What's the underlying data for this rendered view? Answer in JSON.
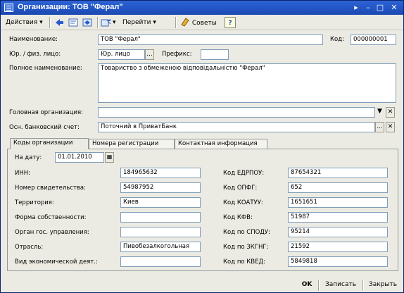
{
  "window": {
    "title": "Организации: ТОВ \"Ферал\""
  },
  "toolbar": {
    "actions_label": "Действия",
    "goto_label": "Перейти",
    "tips_label": "Советы",
    "help_label": "?"
  },
  "form": {
    "name_label": "Наименование:",
    "name_value": "ТОВ \"Ферал\"",
    "code_label": "Код:",
    "code_value": "000000001",
    "entity_label": "Юр. / физ. лицо:",
    "entity_value": "Юр. лицо",
    "prefix_label": "Префикс:",
    "prefix_value": "",
    "fullname_label": "Полное наименование:",
    "fullname_value": "Товариство з обмеженою відповідальністю \"Ферал\"",
    "head_org_label": "Головная организация:",
    "head_org_value": "",
    "bank_label": "Осн. банковский счет:",
    "bank_value": "Поточний в ПриватБанк"
  },
  "tabs": [
    {
      "label": "Коды организации",
      "active": true
    },
    {
      "label": "Номера регистрации",
      "active": false
    },
    {
      "label": "Контактная информация",
      "active": false
    }
  ],
  "codes": {
    "date_label": "На дату:",
    "date_value": "01.01.2010",
    "left": [
      {
        "label": "ИНН:",
        "value": "184965632"
      },
      {
        "label": "Номер свидетельства:",
        "value": "54987952"
      },
      {
        "label": "Территория:",
        "value": "Киев"
      },
      {
        "label": "Форма собственности:",
        "value": ""
      },
      {
        "label": "Орган гос. управления:",
        "value": ""
      },
      {
        "label": "Отрасль:",
        "value": "Пивобезалкогольная"
      },
      {
        "label": "Вид экономической деят.:",
        "value": ""
      }
    ],
    "right": [
      {
        "label": "Код ЕДРПОУ:",
        "value": "87654321"
      },
      {
        "label": "Код ОПФГ:",
        "value": "652"
      },
      {
        "label": "Код КОАТУУ:",
        "value": "1651651"
      },
      {
        "label": "Код КФВ:",
        "value": "51987"
      },
      {
        "label": "Код по СПОДУ:",
        "value": "95214"
      },
      {
        "label": "Код по ЗКГНГ:",
        "value": "21592"
      },
      {
        "label": "Код по КВЕД:",
        "value": "5849818"
      }
    ]
  },
  "footer": {
    "ok_label": "OK",
    "save_label": "Записать",
    "close_label": "Закрыть"
  }
}
